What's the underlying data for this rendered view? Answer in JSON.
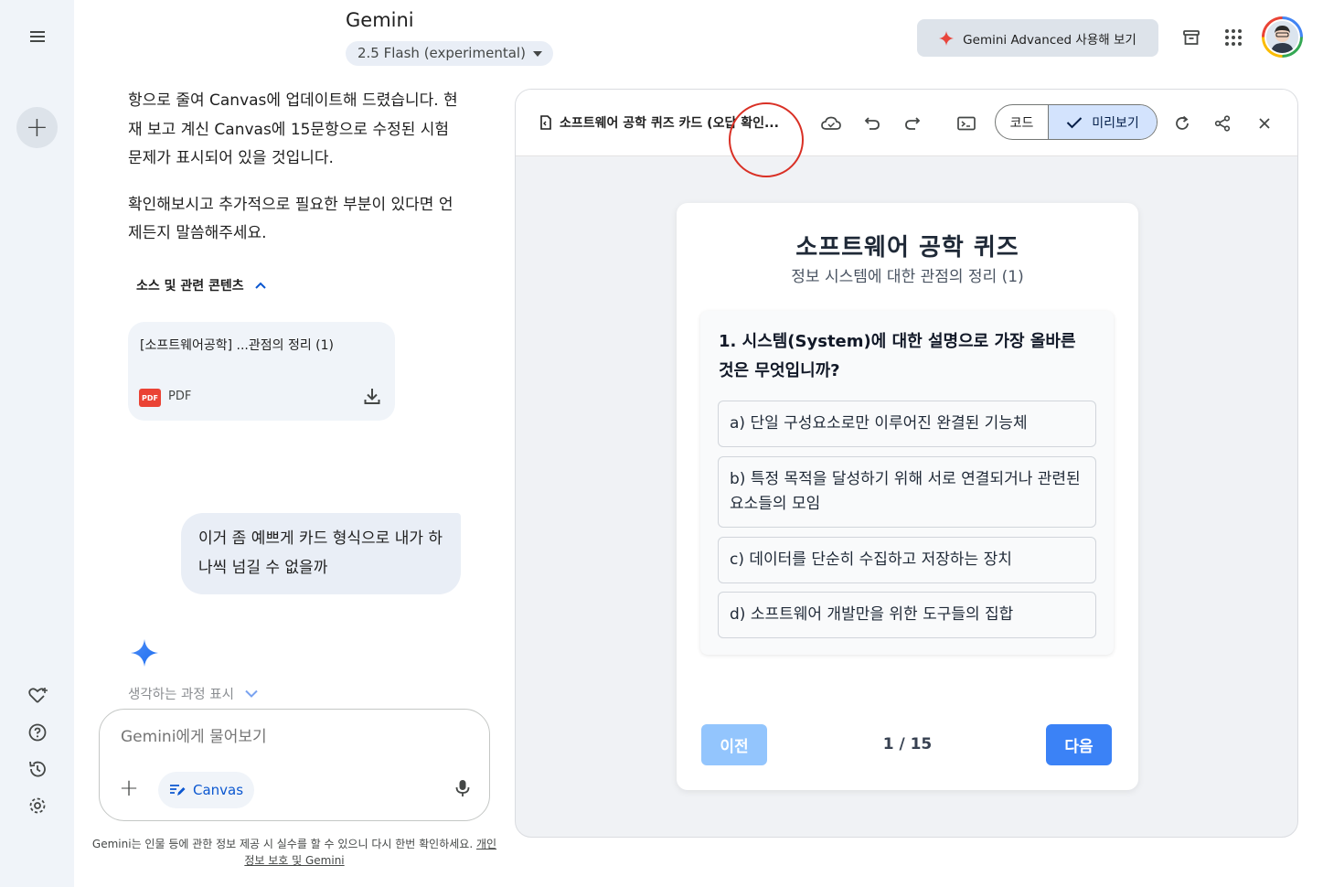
{
  "header": {
    "brand": "Gemini",
    "model_label": "2.5 Flash (experimental)",
    "advanced_button": "Gemini Advanced 사용해 보기"
  },
  "chat": {
    "assistant_paragraphs": [
      "항으로 줄여 Canvas에 업데이트해 드렸습니다. 현재 보고 계신 Canvas에 15문항으로 수정된 시험 문제가 표시되어 있을 것입니다.",
      "확인해보시고 추가적으로 필요한 부분이 있다면 언제든지 말씀해주세요."
    ],
    "sources_label": "소스 및 관련 콘텐츠",
    "source_card": {
      "title": "[소프트웨어공학] ...관점의 정리 (1)",
      "badge": "PDF",
      "type": "PDF"
    },
    "user_message": "이거 좀 예쁘게 카드 형식으로 내가 하나씩 넘길 수 없을까",
    "thinking_label": "생각하는 과정 표시"
  },
  "input": {
    "placeholder": "Gemini에게 물어보기",
    "canvas_chip": "Canvas"
  },
  "disclaimer": {
    "text": "Gemini는 인물 등에 관한 정보 제공 시 실수를 할 수 있으니 다시 한번 확인하세요.",
    "link": "개인 정보 보호 및 Gemini"
  },
  "canvas": {
    "doc_title": "소프트웨어 공학 퀴즈 카드 (오답 확인...",
    "code_tab": "코드",
    "preview_tab": "미리보기"
  },
  "quiz": {
    "title": "소프트웨어 공학 퀴즈",
    "subtitle": "정보 시스템에 대한 관점의 정리 (1)",
    "question": "1. 시스템(System)에 대한 설명으로 가장 올바른 것은 무엇입니까?",
    "options": [
      "a) 단일 구성요소로만 이루어진 완결된 기능체",
      "b) 특정 목적을 달성하기 위해 서로 연결되거나 관련된 요소들의 모임",
      "c) 데이터를 단순히 수집하고 저장하는 장치",
      "d) 소프트웨어 개발만을 위한 도구들의 집합"
    ],
    "prev_button": "이전",
    "counter": "1 / 15",
    "next_button": "다음"
  },
  "colors": {
    "accent": "#0b57d0",
    "next_button": "#3b82f6",
    "prev_button_disabled": "#93c5fd",
    "annotation_circle": "#d93025",
    "pdf_badge": "#ea4335"
  },
  "icons": {
    "rail": [
      "menu-icon",
      "new-chat-icon",
      "gem-icon",
      "help-icon",
      "history-icon",
      "settings-icon"
    ],
    "top": [
      "sparkle-icon",
      "archive-icon",
      "apps-grid-icon",
      "avatar"
    ],
    "canvas_bar": [
      "document-icon",
      "cloud-icon",
      "undo-icon",
      "redo-icon",
      "console-icon",
      "check-icon",
      "refresh-icon",
      "share-icon",
      "close-icon"
    ],
    "chat": [
      "chevron-up-icon",
      "download-icon",
      "gemini-spark-icon",
      "chevron-down-icon",
      "plus-icon",
      "canvas-icon",
      "mic-icon"
    ]
  }
}
